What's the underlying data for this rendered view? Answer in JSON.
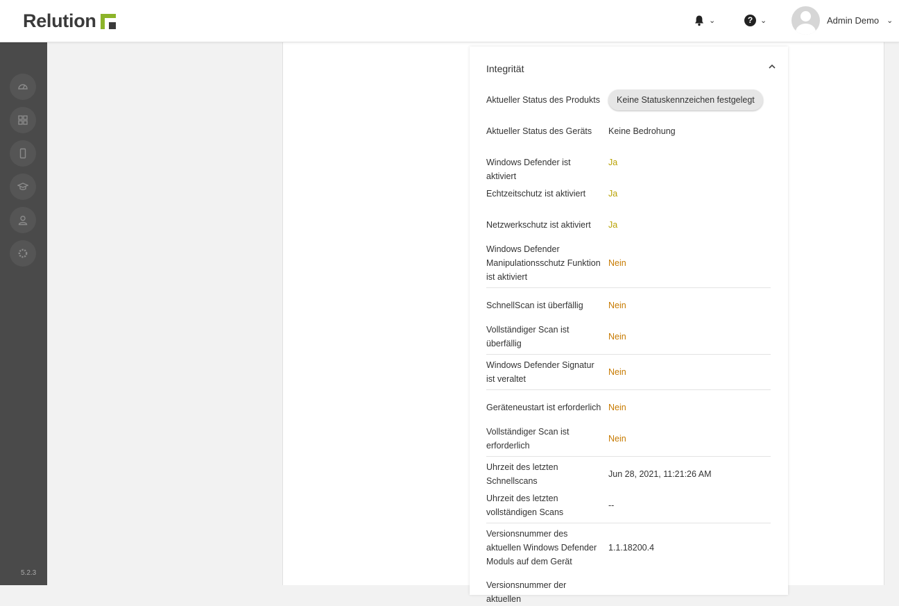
{
  "app": {
    "brand": "Relution",
    "version": "5.2.3"
  },
  "header": {
    "user_name": "Admin Demo",
    "help_glyph": "?"
  },
  "sidebar": {
    "items": [
      {
        "icon": "dashboard-icon"
      },
      {
        "icon": "apps-grid-icon"
      },
      {
        "icon": "device-icon"
      },
      {
        "icon": "education-cap-icon"
      },
      {
        "icon": "user-icon"
      },
      {
        "icon": "gear-icon"
      }
    ]
  },
  "card": {
    "title": "Integrität",
    "rows": [
      {
        "label": "Aktueller Status des Produkts",
        "value": "Keine Statuskennzeichen festgelegt",
        "kind": "chip"
      },
      {
        "label": "Aktueller Status des Geräts",
        "value": "Keine Bedrohung",
        "kind": "plain"
      },
      {
        "label": "Windows Defender ist aktiviert",
        "value": "Ja",
        "kind": "yes"
      },
      {
        "label": "Echtzeitschutz ist aktiviert",
        "value": "Ja",
        "kind": "yes"
      },
      {
        "label": "Netzwerkschutz ist aktiviert",
        "value": "Ja",
        "kind": "yes"
      },
      {
        "label": "Windows Defender Manipulationsschutz Funktion ist aktiviert",
        "value": "Nein",
        "kind": "no"
      },
      {
        "label": "SchnellScan ist überfällig",
        "value": "Nein",
        "kind": "no"
      },
      {
        "label": "Vollständiger Scan ist überfällig",
        "value": "Nein",
        "kind": "no"
      },
      {
        "label": "Windows Defender Signatur ist veraltet",
        "value": "Nein",
        "kind": "no"
      },
      {
        "label": "Geräteneustart ist erforderlich",
        "value": "Nein",
        "kind": "no"
      },
      {
        "label": "Vollständiger Scan ist erforderlich",
        "value": "Nein",
        "kind": "no"
      },
      {
        "label": "Uhrzeit des letzten Schnellscans",
        "value": "Jun 28, 2021, 11:21:26 AM",
        "kind": "plain"
      },
      {
        "label": "Uhrzeit des letzten vollständigen Scans",
        "value": "--",
        "kind": "plain"
      },
      {
        "label": "Versionsnummer des aktuellen Windows Defender Moduls auf dem Gerät",
        "value": "1.1.18200.4",
        "kind": "plain"
      },
      {
        "label": "Versionsnummer der aktuellen",
        "value": "",
        "kind": "plain"
      }
    ]
  }
}
